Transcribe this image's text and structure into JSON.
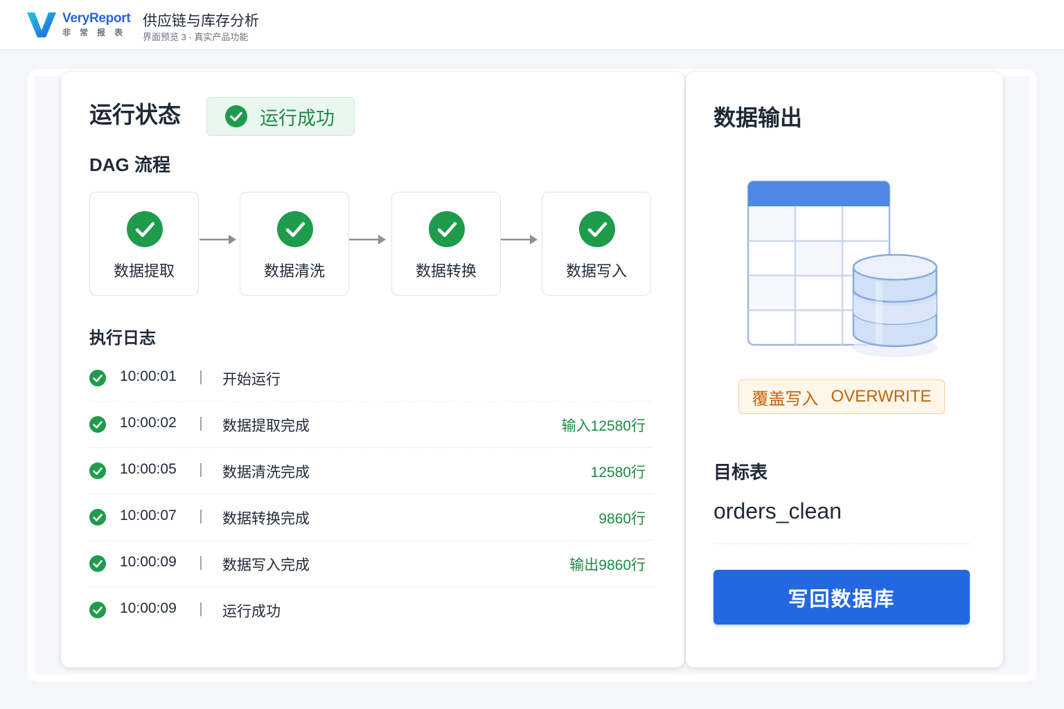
{
  "header": {
    "brand_en": "VeryReport",
    "brand_cn": "非常报表",
    "title": "供应链与库存分析",
    "subtitle": "界面预览 3 · 真实产品功能"
  },
  "status": {
    "heading": "运行状态",
    "badge": "运行成功"
  },
  "dag": {
    "heading": "DAG 流程",
    "steps": [
      {
        "label": "数据提取"
      },
      {
        "label": "数据清洗"
      },
      {
        "label": "数据转换"
      },
      {
        "label": "数据写入"
      }
    ]
  },
  "log": {
    "heading": "执行日志",
    "rows": [
      {
        "time": "10:00:01",
        "message": "开始运行",
        "count": ""
      },
      {
        "time": "10:00:02",
        "message": "数据提取完成",
        "count": "输入12580行"
      },
      {
        "time": "10:00:05",
        "message": "数据清洗完成",
        "count": "12580行"
      },
      {
        "time": "10:00:07",
        "message": "数据转换完成",
        "count": "9860行"
      },
      {
        "time": "10:00:09",
        "message": "数据写入完成",
        "count": "输出9860行"
      },
      {
        "time": "10:00:09",
        "message": "运行成功",
        "count": ""
      }
    ]
  },
  "output": {
    "heading": "数据输出",
    "mode_cn": "覆盖写入",
    "mode_en": "OVERWRITE",
    "target_label": "目标表",
    "target_name": "orders_clean",
    "write_button": "写回数据库"
  },
  "colors": {
    "success": "#1e9b4b",
    "primary": "#2368e1",
    "warning": "#c2620c"
  }
}
